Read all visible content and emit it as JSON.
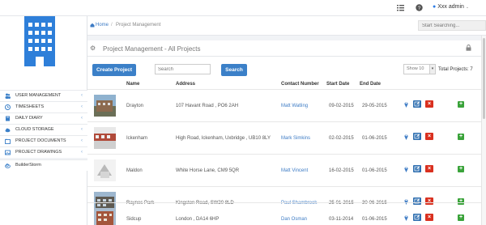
{
  "header": {
    "user_label": "Xxx admin",
    "icons": [
      "list-icon",
      "help-icon",
      "user-icon",
      "chevron-down-icon"
    ]
  },
  "sidebar": {
    "logo_icon": "building-icon",
    "items": [
      {
        "label": "USER MANAGEMENT",
        "icon": "users-icon"
      },
      {
        "label": "TIMESHEETS",
        "icon": "clock-icon"
      },
      {
        "label": "DAILY DIARY",
        "icon": "book-icon"
      },
      {
        "label": "CLOUD STORAGE",
        "icon": "cloud-icon"
      },
      {
        "label": "PROJECT DOCUMENTS",
        "icon": "folder-icon"
      },
      {
        "label": "PROJECT DRAWINGS",
        "icon": "image-icon"
      },
      {
        "label": "BuilderStorm",
        "icon": "cloud-brand-icon"
      }
    ]
  },
  "breadcrumb": {
    "home": "Home",
    "separator": "/",
    "current": "Project Management",
    "search_placeholder": "Start Searching..."
  },
  "panel": {
    "title": "Project Management - All Projects"
  },
  "toolbar": {
    "create_label": "Create Project",
    "search_placeholder": "Search",
    "search_label": "Search",
    "show_value": "Show 10",
    "total_label": "Total Projects: 7"
  },
  "table": {
    "headers": {
      "name": "Name",
      "address": "Address",
      "contact": "Contact Number",
      "start": "Start Date",
      "end": "End Date"
    },
    "rows": [
      {
        "name": "Drayton",
        "address": "107 Havant Road , PO6 2AH",
        "contact": "Matt Watling",
        "start": "09-02-2015",
        "end": "29-05-2015"
      },
      {
        "name": "Ickenham",
        "address": "High Road, Ickenham, Uxbridge , UB10 8LY",
        "contact": "Mark Simkins",
        "start": "02-02-2015",
        "end": "01-06-2015"
      },
      {
        "name": "Maldon",
        "address": "White Horse Lane, CM9 5QR",
        "contact": "Matt Vincent",
        "start": "16-02-2015",
        "end": "01-06-2015"
      },
      {
        "name": "Raynes Park",
        "address": "Kingston Road, SW20 8LD",
        "contact": "Paul Shambrook",
        "start": "25-01-2015",
        "end": "30-06-2015"
      },
      {
        "name": "Sidcup",
        "address": "London , DA14 6HP",
        "contact": "Dan Osman",
        "start": "03-11-2014",
        "end": "01-06-2015"
      }
    ]
  },
  "colors": {
    "primary": "#3b80c8",
    "link": "#3e7cc5",
    "delete": "#d9301f",
    "add": "#3aa33a"
  }
}
